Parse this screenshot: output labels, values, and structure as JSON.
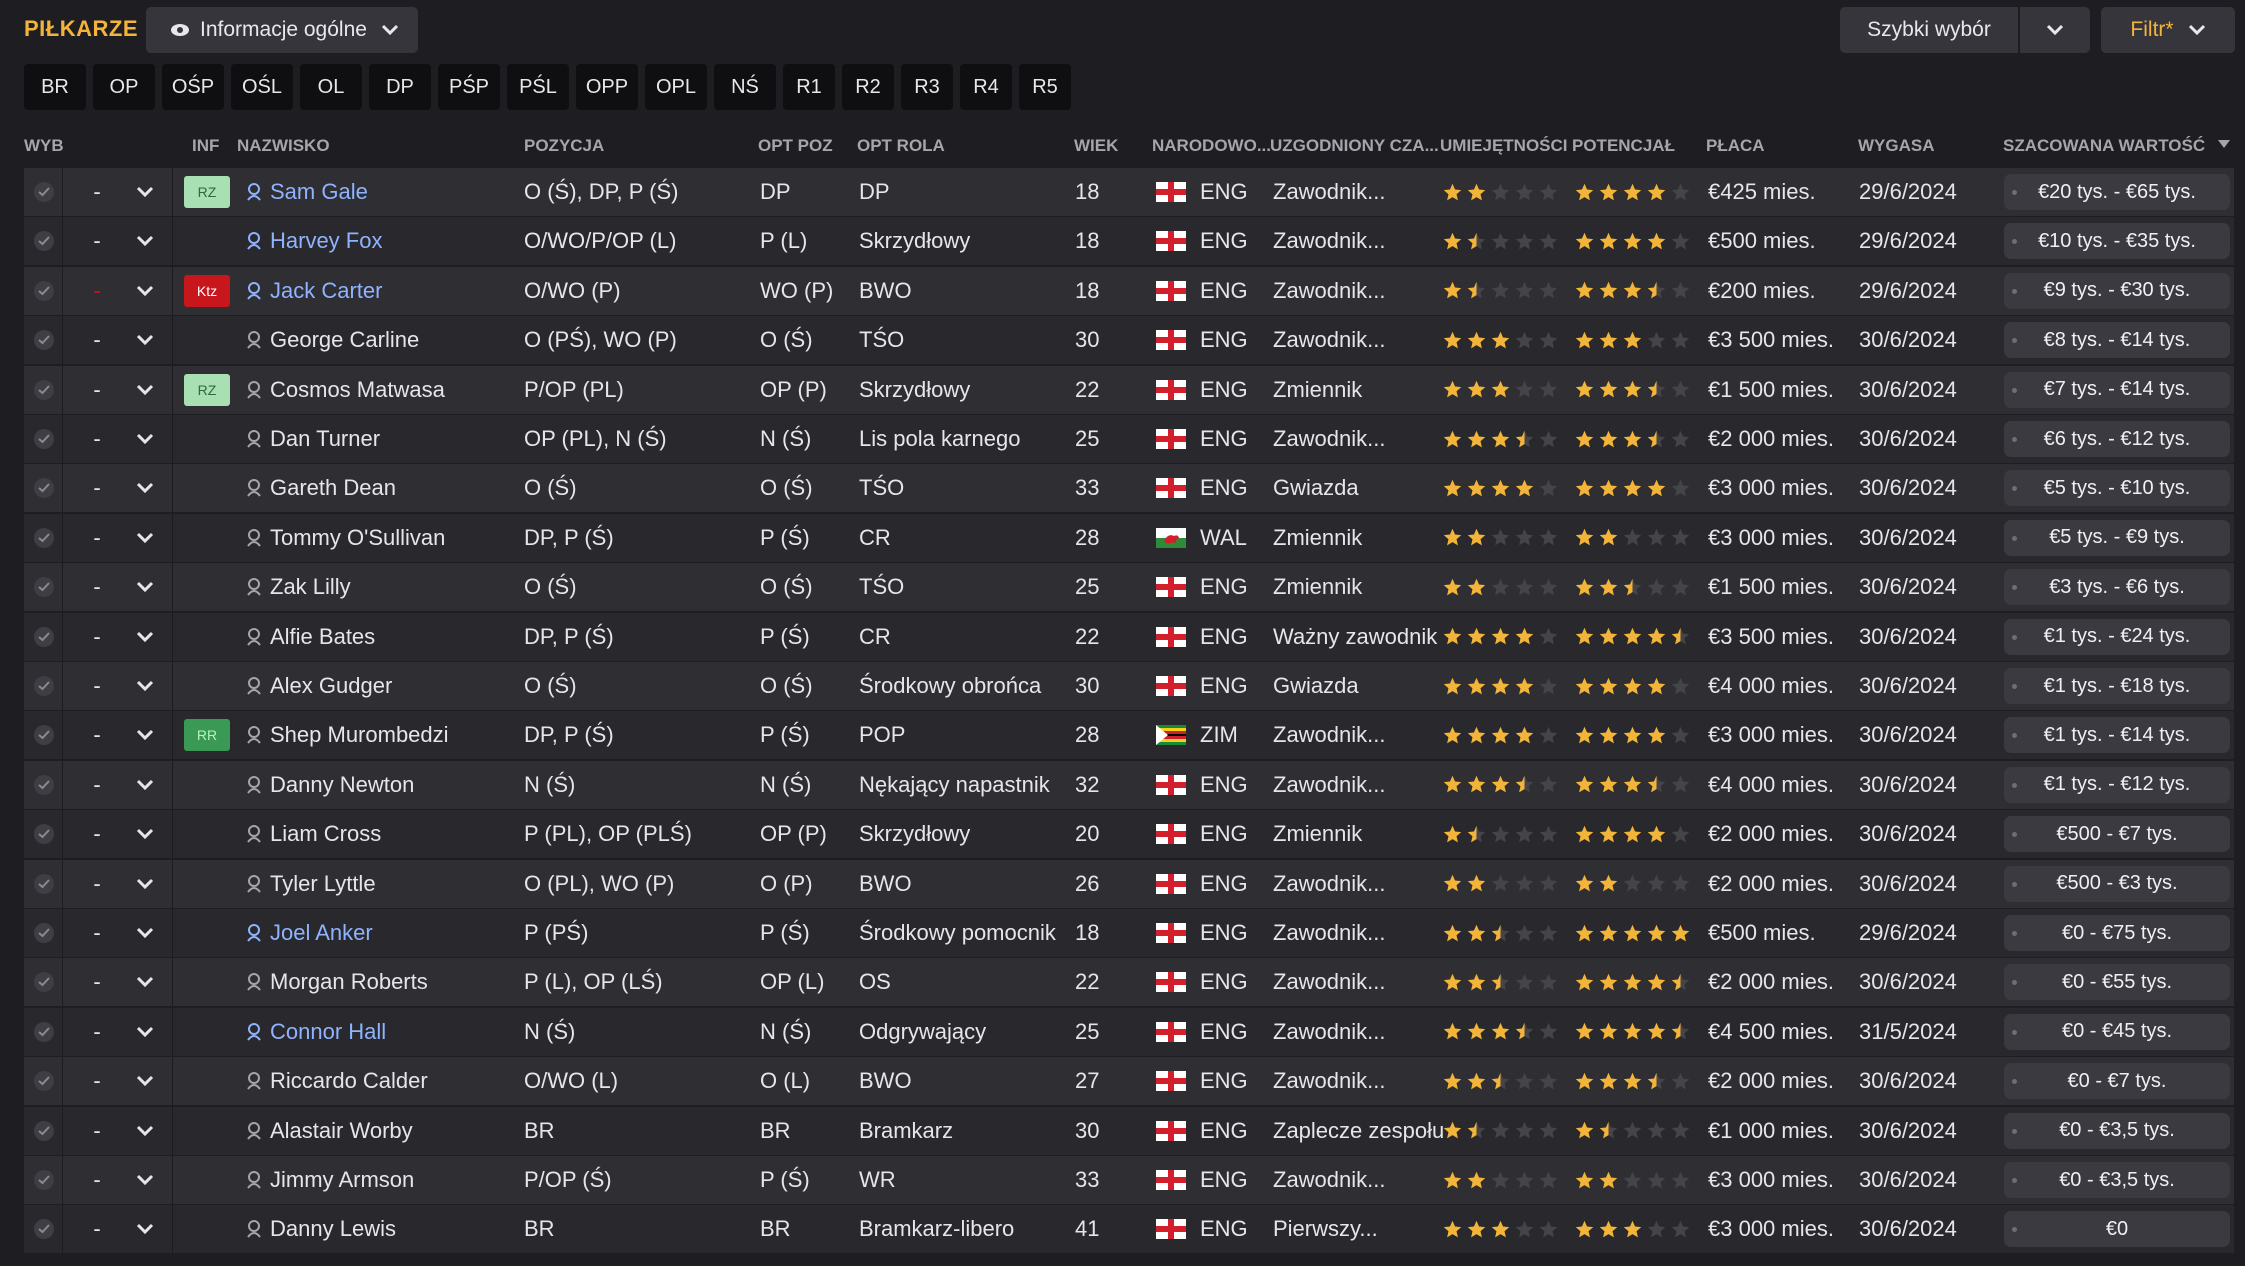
{
  "app": {
    "title": "PIŁKARZE"
  },
  "view_dropdown": {
    "label": "Informacje ogólne"
  },
  "quick_select": {
    "label": "Szybki wybór"
  },
  "filter": {
    "label": "Filtr*"
  },
  "position_tabs": [
    "BR",
    "OP",
    "OŚP",
    "OŚL",
    "OL",
    "DP",
    "PŚP",
    "PŚL",
    "OPP",
    "OPL",
    "NŚ",
    "R1",
    "R2",
    "R3",
    "R4",
    "R5"
  ],
  "columns": {
    "wyb": "WYB",
    "inf": "INF",
    "name": "NAZWISKO",
    "position": "POZYCJA",
    "opt_pos": "OPT POZ",
    "opt_role": "OPT ROLA",
    "age": "WIEK",
    "nationality": "NARODOWO...",
    "playing_time": "UZGODNIONY CZA...",
    "ability": "UMIEJĘTNOŚCI",
    "potential": "POTENCJAŁ",
    "wage": "PŁACA",
    "expires": "WYGASA",
    "value": "SZACOWANA WARTOŚĆ"
  },
  "colors": {
    "accent": "#f3b43a",
    "star": "#f3b43a",
    "highlight_name": "#8fb3ff"
  },
  "players": [
    {
      "sel": "-",
      "badge": "RZ",
      "badge_style": "light-green",
      "name": "Sam Gale",
      "highlight": true,
      "position": "O (Ś), DP, P (Ś)",
      "opt_pos": "DP",
      "opt_role": "DP",
      "age": "18",
      "flag": "ENG",
      "nat": "ENG",
      "time": "Zawodnik...",
      "ability": 2,
      "potential": 4,
      "wage": "€425 mies.",
      "expires": "29/6/2024",
      "value": "€20 tys. - €65 tys."
    },
    {
      "sel": "-",
      "badge": "",
      "name": "Harvey Fox",
      "highlight": true,
      "position": "O/WO/P/OP (L)",
      "opt_pos": "P (L)",
      "opt_role": "Skrzydłowy",
      "age": "18",
      "flag": "ENG",
      "nat": "ENG",
      "time": "Zawodnik...",
      "ability": 1.5,
      "potential": 4,
      "wage": "€500 mies.",
      "expires": "29/6/2024",
      "value": "€10 tys. - €35 tys."
    },
    {
      "sel": "-",
      "sel_red": true,
      "badge": "Ktz",
      "badge_style": "red",
      "name": "Jack Carter",
      "highlight": true,
      "position": "O/WO (P)",
      "opt_pos": "WO (P)",
      "opt_role": "BWO",
      "age": "18",
      "flag": "ENG",
      "nat": "ENG",
      "time": "Zawodnik...",
      "ability": 1.5,
      "potential": 3.5,
      "wage": "€200 mies.",
      "expires": "29/6/2024",
      "value": "€9 tys. - €30 tys."
    },
    {
      "sel": "-",
      "badge": "",
      "name": "George Carline",
      "position": "O (PŚ), WO (P)",
      "opt_pos": "O (Ś)",
      "opt_role": "TŚO",
      "age": "30",
      "flag": "ENG",
      "nat": "ENG",
      "time": "Zawodnik...",
      "ability": 3,
      "potential": 3,
      "wage": "€3 500 mies.",
      "expires": "30/6/2024",
      "value": "€8 tys. - €14 tys."
    },
    {
      "sel": "-",
      "badge": "RZ",
      "badge_style": "light-green",
      "name": "Cosmos Matwasa",
      "position": "P/OP (PL)",
      "opt_pos": "OP (P)",
      "opt_role": "Skrzydłowy",
      "age": "22",
      "flag": "ENG",
      "nat": "ENG",
      "time": "Zmiennik",
      "ability": 3,
      "potential": 3.5,
      "wage": "€1 500 mies.",
      "expires": "30/6/2024",
      "value": "€7 tys. - €14 tys."
    },
    {
      "sel": "-",
      "badge": "",
      "name": "Dan Turner",
      "position": "OP (PL), N (Ś)",
      "opt_pos": "N (Ś)",
      "opt_role": "Lis pola karnego",
      "age": "25",
      "flag": "ENG",
      "nat": "ENG",
      "time": "Zawodnik...",
      "ability": 3.5,
      "potential": 3.5,
      "wage": "€2 000 mies.",
      "expires": "30/6/2024",
      "value": "€6 tys. - €12 tys."
    },
    {
      "sel": "-",
      "badge": "",
      "name": "Gareth Dean",
      "position": "O (Ś)",
      "opt_pos": "O (Ś)",
      "opt_role": "TŚO",
      "age": "33",
      "flag": "ENG",
      "nat": "ENG",
      "time": "Gwiazda",
      "ability": 4,
      "potential": 4,
      "wage": "€3 000 mies.",
      "expires": "30/6/2024",
      "value": "€5 tys. - €10 tys."
    },
    {
      "sel": "-",
      "badge": "",
      "name": "Tommy O'Sullivan",
      "position": "DP, P (Ś)",
      "opt_pos": "P (Ś)",
      "opt_role": "CR",
      "age": "28",
      "flag": "WAL",
      "nat": "WAL",
      "time": "Zmiennik",
      "ability": 2,
      "potential": 2,
      "wage": "€3 000 mies.",
      "expires": "30/6/2024",
      "value": "€5 tys. - €9 tys."
    },
    {
      "sel": "-",
      "badge": "",
      "name": "Zak Lilly",
      "position": "O (Ś)",
      "opt_pos": "O (Ś)",
      "opt_role": "TŚO",
      "age": "25",
      "flag": "ENG",
      "nat": "ENG",
      "time": "Zmiennik",
      "ability": 2,
      "potential": 2.5,
      "wage": "€1 500 mies.",
      "expires": "30/6/2024",
      "value": "€3 tys. - €6 tys."
    },
    {
      "sel": "-",
      "badge": "",
      "name": "Alfie Bates",
      "position": "DP, P (Ś)",
      "opt_pos": "P (Ś)",
      "opt_role": "CR",
      "age": "22",
      "flag": "ENG",
      "nat": "ENG",
      "time": "Ważny zawodnik",
      "ability": 4,
      "potential": 4.5,
      "wage": "€3 500 mies.",
      "expires": "30/6/2024",
      "value": "€1 tys. - €24 tys."
    },
    {
      "sel": "-",
      "badge": "",
      "name": "Alex Gudger",
      "position": "O (Ś)",
      "opt_pos": "O (Ś)",
      "opt_role": "Środkowy obrońca",
      "age": "30",
      "flag": "ENG",
      "nat": "ENG",
      "time": "Gwiazda",
      "ability": 4,
      "potential": 4,
      "wage": "€4 000 mies.",
      "expires": "30/6/2024",
      "value": "€1 tys. - €18 tys."
    },
    {
      "sel": "-",
      "badge": "RR",
      "badge_style": "green",
      "name": "Shep Murombedzi",
      "position": "DP, P (Ś)",
      "opt_pos": "P (Ś)",
      "opt_role": "POP",
      "age": "28",
      "flag": "ZIM",
      "nat": "ZIM",
      "time": "Zawodnik...",
      "ability": 4,
      "potential": 4,
      "wage": "€3 000 mies.",
      "expires": "30/6/2024",
      "value": "€1 tys. - €14 tys."
    },
    {
      "sel": "-",
      "badge": "",
      "name": "Danny Newton",
      "position": "N (Ś)",
      "opt_pos": "N (Ś)",
      "opt_role": "Nękający napastnik",
      "age": "32",
      "flag": "ENG",
      "nat": "ENG",
      "time": "Zawodnik...",
      "ability": 3.5,
      "potential": 3.5,
      "wage": "€4 000 mies.",
      "expires": "30/6/2024",
      "value": "€1 tys. - €12 tys."
    },
    {
      "sel": "-",
      "badge": "",
      "name": "Liam Cross",
      "position": "P (PL), OP (PLŚ)",
      "opt_pos": "OP (P)",
      "opt_role": "Skrzydłowy",
      "age": "20",
      "flag": "ENG",
      "nat": "ENG",
      "time": "Zmiennik",
      "ability": 1.5,
      "potential": 4,
      "wage": "€2 000 mies.",
      "expires": "30/6/2024",
      "value": "€500 - €7 tys."
    },
    {
      "sel": "-",
      "badge": "",
      "name": "Tyler Lyttle",
      "position": "O (PL), WO (P)",
      "opt_pos": "O (P)",
      "opt_role": "BWO",
      "age": "26",
      "flag": "ENG",
      "nat": "ENG",
      "time": "Zawodnik...",
      "ability": 2,
      "potential": 2,
      "wage": "€2 000 mies.",
      "expires": "30/6/2024",
      "value": "€500 - €3 tys."
    },
    {
      "sel": "-",
      "badge": "",
      "name": "Joel Anker",
      "highlight": true,
      "position": "P (PŚ)",
      "opt_pos": "P (Ś)",
      "opt_role": "Środkowy pomocnik",
      "age": "18",
      "flag": "ENG",
      "nat": "ENG",
      "time": "Zawodnik...",
      "ability": 2.5,
      "potential": 5,
      "wage": "€500 mies.",
      "expires": "29/6/2024",
      "value": "€0 - €75 tys."
    },
    {
      "sel": "-",
      "badge": "",
      "name": "Morgan Roberts",
      "position": "P (L), OP (LŚ)",
      "opt_pos": "OP (L)",
      "opt_role": "OS",
      "age": "22",
      "flag": "ENG",
      "nat": "ENG",
      "time": "Zawodnik...",
      "ability": 2.5,
      "potential": 4.5,
      "wage": "€2 000 mies.",
      "expires": "30/6/2024",
      "value": "€0 - €55 tys."
    },
    {
      "sel": "-",
      "badge": "",
      "name": "Connor Hall",
      "highlight": true,
      "position": "N (Ś)",
      "opt_pos": "N (Ś)",
      "opt_role": "Odgrywający",
      "age": "25",
      "flag": "ENG",
      "nat": "ENG",
      "time": "Zawodnik...",
      "ability": 3.5,
      "potential": 4.5,
      "wage": "€4 500 mies.",
      "expires": "31/5/2024",
      "value": "€0 - €45 tys."
    },
    {
      "sel": "-",
      "badge": "",
      "name": "Riccardo Calder",
      "position": "O/WO (L)",
      "opt_pos": "O (L)",
      "opt_role": "BWO",
      "age": "27",
      "flag": "ENG",
      "nat": "ENG",
      "time": "Zawodnik...",
      "ability": 2.5,
      "potential": 3.5,
      "wage": "€2 000 mies.",
      "expires": "30/6/2024",
      "value": "€0 - €7 tys."
    },
    {
      "sel": "-",
      "badge": "",
      "name": "Alastair Worby",
      "position": "BR",
      "opt_pos": "BR",
      "opt_role": "Bramkarz",
      "age": "30",
      "flag": "ENG",
      "nat": "ENG",
      "time": "Zaplecze zespołu",
      "ability": 1.5,
      "potential": 1.5,
      "wage": "€1 000 mies.",
      "expires": "30/6/2024",
      "value": "€0 - €3,5 tys."
    },
    {
      "sel": "-",
      "badge": "",
      "name": "Jimmy Armson",
      "position": "P/OP (Ś)",
      "opt_pos": "P (Ś)",
      "opt_role": "WR",
      "age": "33",
      "flag": "ENG",
      "nat": "ENG",
      "time": "Zawodnik...",
      "ability": 2,
      "potential": 2,
      "wage": "€3 000 mies.",
      "expires": "30/6/2024",
      "value": "€0 - €3,5 tys."
    },
    {
      "sel": "-",
      "badge": "",
      "name": "Danny Lewis",
      "position": "BR",
      "opt_pos": "BR",
      "opt_role": "Bramkarz-libero",
      "age": "41",
      "flag": "ENG",
      "nat": "ENG",
      "time": "Pierwszy...",
      "ability": 3,
      "potential": 3,
      "wage": "€3 000 mies.",
      "expires": "30/6/2024",
      "value": "€0"
    }
  ]
}
